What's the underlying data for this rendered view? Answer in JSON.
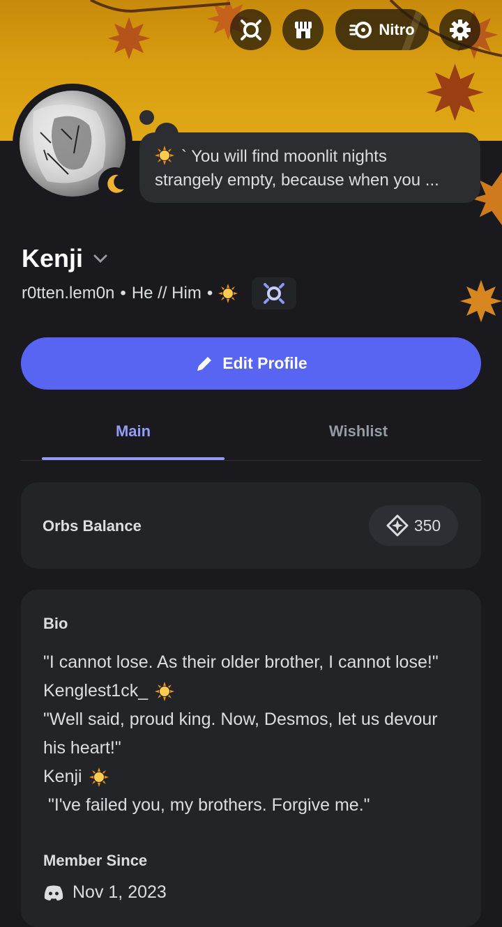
{
  "header": {
    "nitro_label": "Nitro"
  },
  "status_bubble": {
    "line1": "` You will find moonlit nights",
    "line2": "strangely empty, because when you ..."
  },
  "profile": {
    "display_name": "Kenji",
    "username": "r0tten.lem0n",
    "pronouns": "He // Him",
    "separator": "•"
  },
  "actions": {
    "edit_profile_label": "Edit Profile"
  },
  "tabs": [
    {
      "label": "Main",
      "active": true
    },
    {
      "label": "Wishlist",
      "active": false
    }
  ],
  "orbs": {
    "label": "Orbs Balance",
    "value": "350"
  },
  "bio": {
    "title": "Bio",
    "lines": [
      "\"I cannot lose. As their older brother, I cannot lose!\"",
      "Kenglest1ck_",
      "\"Well said, proud king. Now, Desmos, let us devour",
      "his heart!\"",
      "Kenji",
      " \"I've failed you, my brothers. Forgive me.\""
    ]
  },
  "member_since": {
    "title": "Member Since",
    "date": "Nov 1, 2023"
  },
  "colors": {
    "accent": "#5865f2",
    "tab_active": "#949cf7",
    "background": "#1a1a1e",
    "card": "#232428",
    "banner": "#d89d10"
  }
}
